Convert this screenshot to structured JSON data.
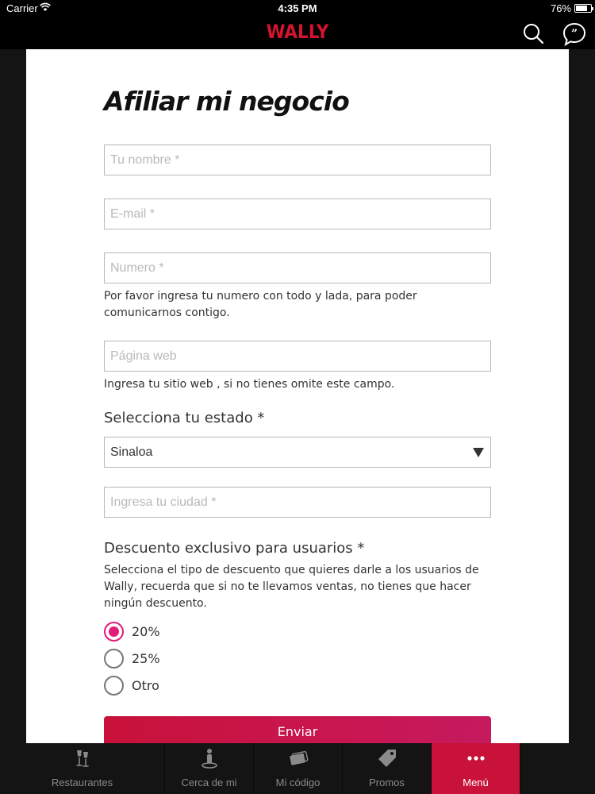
{
  "status_bar": {
    "carrier": "Carrier",
    "time": "4:35 PM",
    "battery": "76%"
  },
  "nav": {
    "logo": "WALLY",
    "search_icon": "search-icon",
    "chat_icon": "chat-bubble-icon"
  },
  "form": {
    "title": "Afiliar mi negocio",
    "name_placeholder": "Tu nombre *",
    "email_placeholder": "E-mail *",
    "number_placeholder": "Numero *",
    "number_help": "Por favor ingresa tu numero con todo y lada, para poder comunicarnos contigo.",
    "website_placeholder": "Página web",
    "website_help": "Ingresa tu sitio web , si no tienes omite este campo.",
    "state_label": "Selecciona tu estado *",
    "state_value": "Sinaloa",
    "city_placeholder": "Ingresa tu ciudad *",
    "discount_label": "Descuento exclusivo para usuarios *",
    "discount_help": "Selecciona el tipo de descuento que quieres darle a los usuarios de Wally, recuerda que si no te llevamos ventas, no tienes que hacer ningún descuento.",
    "discount_options": [
      {
        "label": "20%",
        "selected": true
      },
      {
        "label": "25%",
        "selected": false
      },
      {
        "label": "Otro",
        "selected": false
      }
    ],
    "submit_label": "Enviar"
  },
  "tabs": [
    {
      "label": "Restaurantes",
      "icon": "wine-glasses-icon",
      "active": false
    },
    {
      "label": "Cerca de mi",
      "icon": "person-location-icon",
      "active": false
    },
    {
      "label": "Mi código",
      "icon": "card-icon",
      "active": false
    },
    {
      "label": "Promos",
      "icon": "tag-icon",
      "active": false
    },
    {
      "label": "Menú",
      "icon": "more-dots-icon",
      "active": true
    }
  ],
  "colors": {
    "brand": "#d4142f",
    "accent": "#e31a79",
    "button": "#c8123a"
  }
}
